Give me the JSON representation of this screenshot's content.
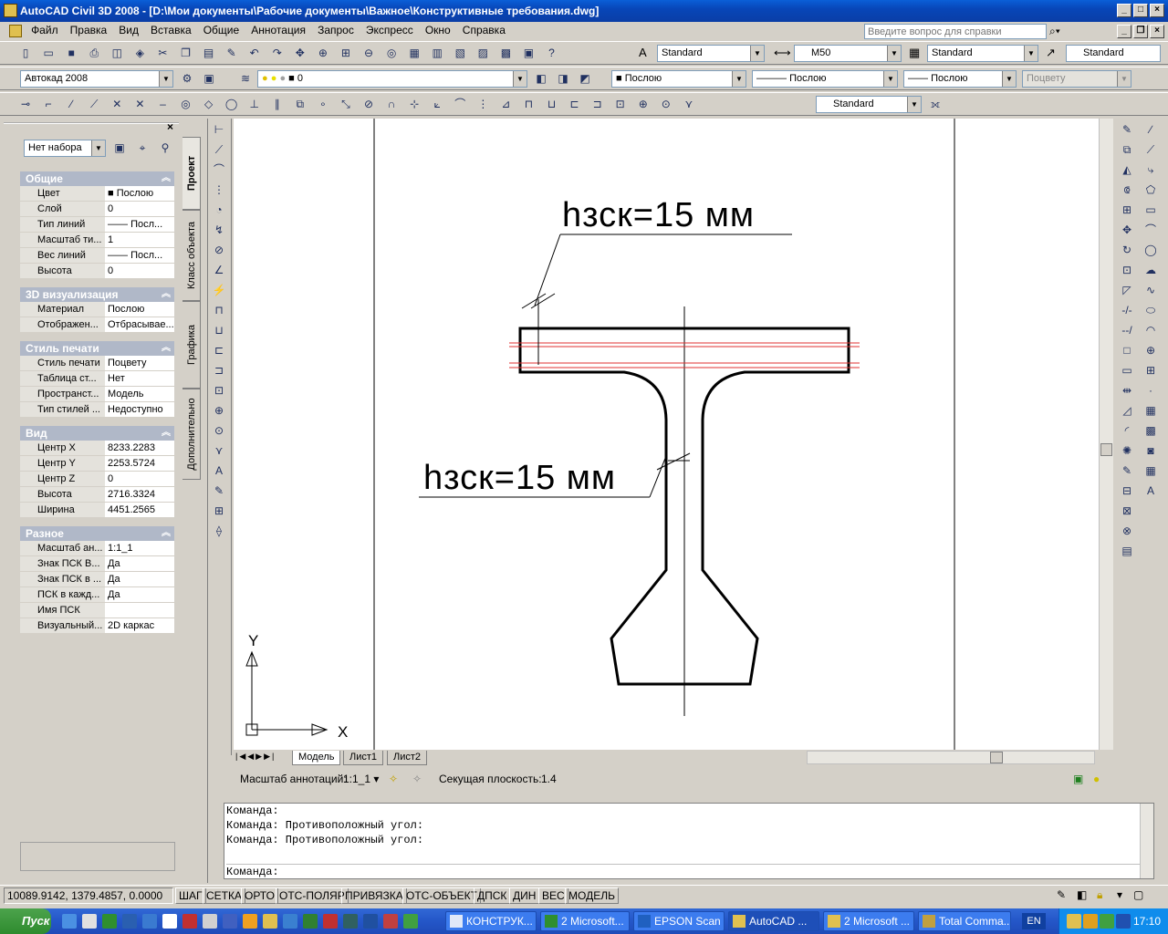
{
  "window": {
    "title": "AutoCAD Civil 3D 2008 - [D:\\Мои документы\\Рабочие документы\\Важное\\Конструктивные требования.dwg]"
  },
  "menu": [
    "Файл",
    "Правка",
    "Вид",
    "Вставка",
    "Общие",
    "Аннотация",
    "Запрос",
    "Экспресс",
    "Окно",
    "Справка"
  ],
  "help": {
    "placeholder": "Введите вопрос для справки"
  },
  "toolbar1": {
    "text_style": "Standard",
    "dim_style": "M50",
    "table_style": "Standard",
    "mleader_style": "Standard"
  },
  "toolbar2": {
    "workspace": "Автокад 2008",
    "layer": "0",
    "color": "Послою",
    "linetype": "Послою",
    "lineweight": "Послою",
    "plotstyle": "Поцвету"
  },
  "toolbar3": {
    "dim_style2": "Standard"
  },
  "properties": {
    "selection": "Нет набора",
    "sections": [
      {
        "title": "Общие",
        "rows": [
          [
            "Цвет",
            "Послою"
          ],
          [
            "Слой",
            "0"
          ],
          [
            "Тип линий",
            "Посл..."
          ],
          [
            "Масштаб ти...",
            "1"
          ],
          [
            "Вес линий",
            "Посл..."
          ],
          [
            "Высота",
            "0"
          ]
        ]
      },
      {
        "title": "3D визуализация",
        "rows": [
          [
            "Материал",
            "Послою"
          ],
          [
            "Отображен...",
            "Отбрасывае..."
          ]
        ]
      },
      {
        "title": "Стиль печати",
        "rows": [
          [
            "Стиль печати",
            "Поцвету"
          ],
          [
            "Таблица ст...",
            "Нет"
          ],
          [
            "Пространст...",
            "Модель"
          ],
          [
            "Тип стилей ...",
            "Недоступно"
          ]
        ]
      },
      {
        "title": "Вид",
        "rows": [
          [
            "Центр X",
            "8233.2283"
          ],
          [
            "Центр Y",
            "2253.5724"
          ],
          [
            "Центр Z",
            "0"
          ],
          [
            "Высота",
            "2716.3324"
          ],
          [
            "Ширина",
            "4451.2565"
          ]
        ]
      },
      {
        "title": "Разное",
        "rows": [
          [
            "Масштаб ан...",
            "1:1_1"
          ],
          [
            "Знак ПСК В...",
            "Да"
          ],
          [
            "Знак ПСК в ...",
            "Да"
          ],
          [
            "ПСК в кажд...",
            "Да"
          ],
          [
            "Имя ПСК",
            ""
          ],
          [
            "Визуальный...",
            "2D каркас"
          ]
        ]
      }
    ],
    "tabs": [
      "Проект",
      "Класс объекта",
      "Графика",
      "Дополнительно"
    ]
  },
  "drawing": {
    "label_top": "hзск=15 мм",
    "label_mid": "hзск=15 мм",
    "axis_x": "X",
    "axis_y": "Y"
  },
  "layout_tabs": [
    "Модель",
    "Лист1",
    "Лист2"
  ],
  "annotation_bar": {
    "scale_label": "Масштаб аннотаций:",
    "scale_value": "1:1_1",
    "cut_label": "Секущая плоскость:",
    "cut_value": "1.4"
  },
  "command_lines": [
    "Команда:",
    "Команда: Противоположный угол:",
    "Команда: Противоположный угол:"
  ],
  "command_prompt": "Команда:",
  "status": {
    "coords": "10089.9142, 1379.4857, 0.0000",
    "toggles": [
      "ШАГ",
      "СЕТКА",
      "ОРТО",
      "ОТС-ПОЛЯР",
      "ПРИВЯЗКА",
      "ОТС-ОБЪЕКТ",
      "ДПСК",
      "ДИН",
      "ВЕС",
      "МОДЕЛЬ"
    ]
  },
  "taskbar": {
    "start": "Пуск",
    "tasks": [
      "КОНСТРУК...",
      "2 Microsoft...",
      "EPSON Scan",
      "AutoCAD ...",
      "2 Microsoft ...",
      "Total Comma..."
    ],
    "lang": "EN",
    "clock": "17:10"
  }
}
